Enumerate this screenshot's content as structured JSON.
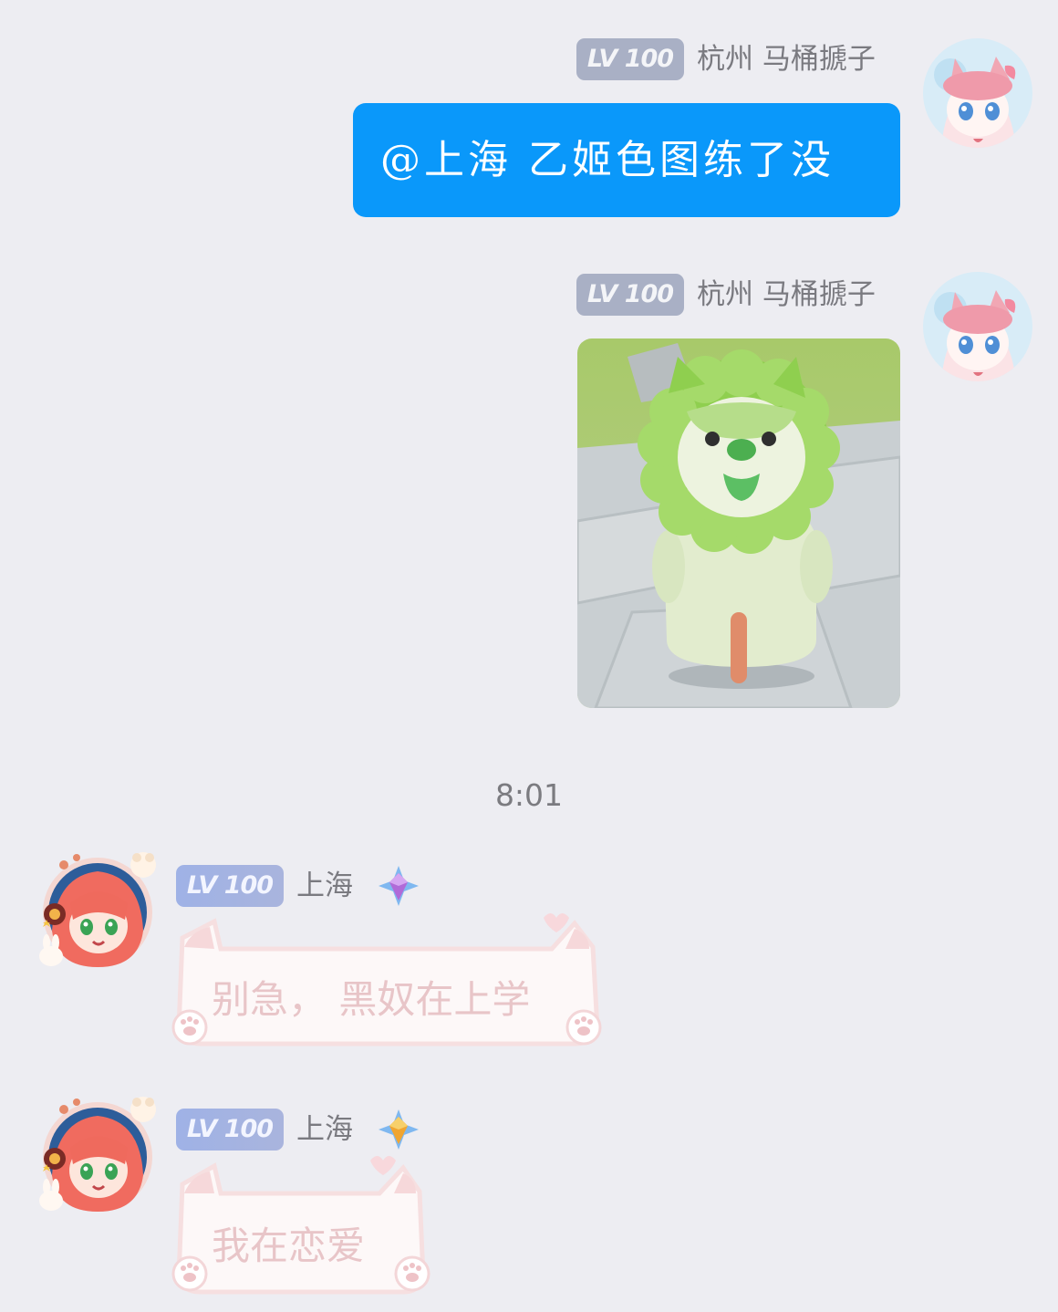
{
  "messages": [
    {
      "side": "right",
      "level": "LV 100",
      "sender": "杭州 马桶搋子",
      "text": "@上海   乙姬色图练了没"
    },
    {
      "side": "right",
      "level": "LV 100",
      "sender": "杭州 马桶搋子",
      "image": "green-cabbage-dog-figure"
    },
    {
      "side": "left",
      "level": "LV 100",
      "sender": "上海",
      "badge": "purple-star-badge",
      "text": "别急， 黑奴在上学"
    },
    {
      "side": "left",
      "level": "LV 100",
      "sender": "上海",
      "badge": "gold-star-badge",
      "text": "我在恋爱"
    }
  ],
  "timestamp": "8:01",
  "colors": {
    "background": "#ededf2",
    "blue_bubble": "#0a98fa",
    "lv_badge_gray": "#a9b0c5",
    "lv_badge_blue": "#a3b3e2",
    "pink_text": "#e8c5c8"
  }
}
